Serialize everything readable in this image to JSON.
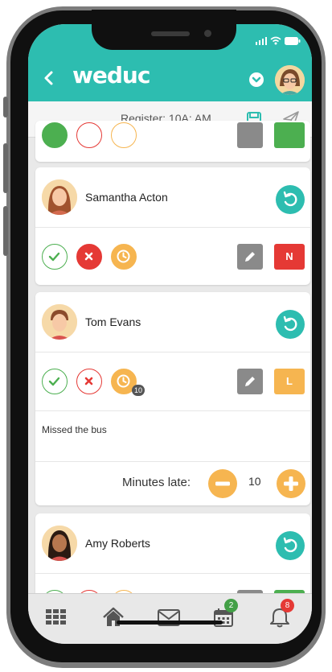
{
  "app": {
    "logo_text": "weduc",
    "brand_color": "#2dbdb0",
    "late_color": "#f6b550",
    "absent_color": "#e53935",
    "present_color": "#4caf50"
  },
  "subheader": {
    "title": "Register: 10A: AM"
  },
  "students": [
    {
      "name": "Samantha Acton",
      "status": "absent",
      "code": "N",
      "code_color": "#e53935"
    },
    {
      "name": "Tom Evans",
      "status": "late",
      "code": "L",
      "code_color": "#f6b550",
      "late_badge": "10",
      "note": "Missed the bus",
      "minutes_label": "Minutes late:",
      "minutes_value": "10"
    },
    {
      "name": "Amy Roberts",
      "status": "unmarked"
    }
  ],
  "bottom_nav": {
    "items": [
      {
        "icon": "grid-icon"
      },
      {
        "icon": "home-icon"
      },
      {
        "icon": "mail-icon"
      },
      {
        "icon": "calendar-icon",
        "badge": "2",
        "badge_color": "#43a047"
      },
      {
        "icon": "bell-icon",
        "badge": "8",
        "badge_color": "#e53935"
      }
    ]
  }
}
